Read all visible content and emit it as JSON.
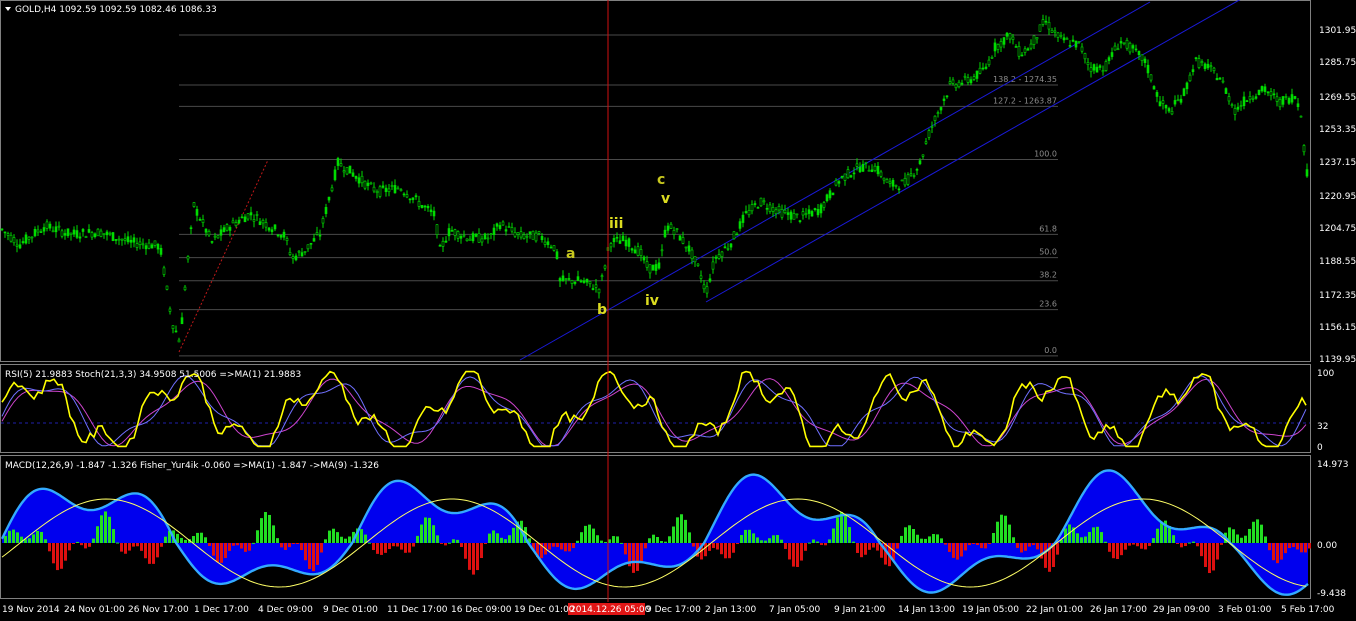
{
  "header": {
    "title": "GOLD,H4  1092.59 1092.59 1082.46 1086.33",
    "menu_icon": "triangle-down-icon"
  },
  "price_axis": {
    "labels": [
      "1301.95",
      "1285.75",
      "1269.55",
      "1253.35",
      "1237.15",
      "1220.95",
      "1204.75",
      "1188.55",
      "1172.35",
      "1156.15",
      "1139.95"
    ],
    "min": 1139.95,
    "max": 1301.95
  },
  "fibonacci": {
    "levels": [
      {
        "label": "0.0",
        "price": 1141.0
      },
      {
        "label": "23.6",
        "price": 1163.8
      },
      {
        "label": "38.2",
        "price": 1178.0
      },
      {
        "label": "50.0",
        "price": 1189.4
      },
      {
        "label": "61.8",
        "price": 1200.8
      },
      {
        "label": "100.0",
        "price": 1237.7
      },
      {
        "label": "127.2 - 1263.87",
        "price": 1263.87
      },
      {
        "label": "138.2 - 1274.35",
        "price": 1274.35
      },
      {
        "label": "",
        "price": 1299.0
      }
    ]
  },
  "waves": [
    "a",
    "b",
    "iii",
    "iv",
    "c",
    "v"
  ],
  "indicator1": {
    "title": "RSI(5) 21.9883  Stoch(21,3,3) 34.9508 51.5006  =>MA(1) 21.9883",
    "axis_labels": [
      "100",
      "32",
      "0"
    ]
  },
  "indicator2": {
    "title": "MACD(12,26,9) -1.847 -1.326  Fisher_Yur4ik -0.060  =>MA(1) -1.847  ->MA(9) -1.326",
    "axis_labels": [
      "14.973",
      "0.00",
      "-9.438"
    ]
  },
  "time_axis": {
    "labels": [
      "19 Nov 2014",
      "24 Nov 01:00",
      "26 Nov 17:00",
      "1 Dec 17:00",
      "4 Dec 09:00",
      "9 Dec 01:00",
      "11 Dec 17:00",
      "16 Dec 09:00",
      "19 Dec 01:00",
      "9 Dec 17:00",
      "2 Jan 13:00",
      "7 Jan 05:00",
      "9 Jan 21:00",
      "14 Jan 13:00",
      "19 Jan 05:00",
      "22 Jan 01:00",
      "26 Jan 17:00",
      "29 Jan 09:00",
      "3 Feb 01:00",
      "5 Feb 17:00"
    ],
    "highlight": "2014.12.26 05:00"
  },
  "colors": {
    "candle": "#00dd00",
    "grid": "#303030",
    "channel": "#1a1ad8",
    "cursor": "#d01010",
    "rsi": "#ffff00",
    "stoch_main": "#7070ff",
    "stoch_signal": "#cc44cc",
    "macd_pos": "#22dd22",
    "macd_neg": "#dd1010",
    "fisher_fill": "#0000ee",
    "fisher_line": "#33aaff",
    "ma_line": "#ffff66"
  }
}
